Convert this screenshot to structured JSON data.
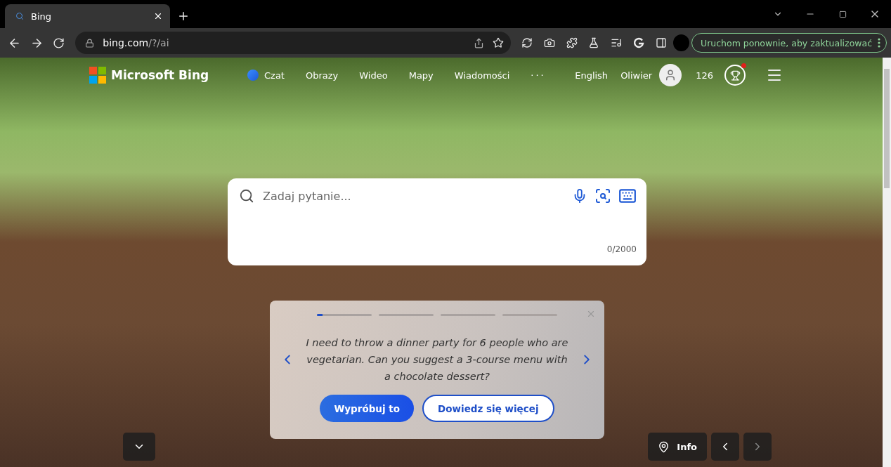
{
  "browser": {
    "tabs": [
      {
        "title": "Bing",
        "selected": true
      }
    ],
    "address": {
      "host": "bing.com",
      "path": "/?/ai"
    },
    "update_button": "Uruchom ponownie, aby zaktualizować"
  },
  "header": {
    "logo": "Microsoft Bing",
    "nav": [
      {
        "label": "Czat",
        "kind": "chat"
      },
      {
        "label": "Obrazy",
        "kind": "link"
      },
      {
        "label": "Wideo",
        "kind": "link"
      },
      {
        "label": "Mapy",
        "kind": "link"
      },
      {
        "label": "Wiadomości",
        "kind": "link"
      },
      {
        "label": "···",
        "kind": "more"
      }
    ],
    "language": "English",
    "user": "Oliwier",
    "points": "126",
    "notification": true
  },
  "search": {
    "placeholder": "Zadaj pytanie...",
    "counter": "0/2000"
  },
  "carousel": {
    "progress": [
      {
        "level": 0.1
      },
      {
        "level": 0
      },
      {
        "level": 0
      },
      {
        "level": 0
      }
    ],
    "prompt": "I need to throw a dinner party for 6 people who are vegetarian. Can you suggest a 3-course menu with a chocolate dessert?",
    "buttons": [
      {
        "label": "Wypróbuj to",
        "kind": "primary"
      },
      {
        "label": "Dowiedz się więcej",
        "kind": "secondary"
      }
    ]
  },
  "footer": {
    "info": "Info"
  }
}
